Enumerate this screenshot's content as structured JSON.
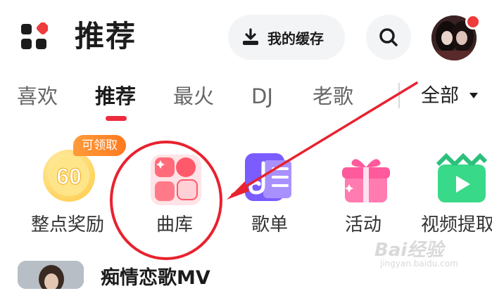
{
  "header": {
    "title": "推荐",
    "cache_label": "我的缓存",
    "icons": [
      "grid-menu-icon",
      "download-icon",
      "search-icon",
      "avatar"
    ]
  },
  "tabs": [
    {
      "label": "喜欢",
      "active": false
    },
    {
      "label": "推荐",
      "active": true
    },
    {
      "label": "最火",
      "active": false
    },
    {
      "label": "DJ",
      "active": false
    },
    {
      "label": "老歌",
      "active": false
    }
  ],
  "tab_all": "全部",
  "entries": [
    {
      "label": "整点奖励",
      "icon": "clock-coin-icon",
      "badge": "可领取",
      "value": "60"
    },
    {
      "label": "曲库",
      "icon": "library-icon"
    },
    {
      "label": "歌单",
      "icon": "playlist-icon"
    },
    {
      "label": "活动",
      "icon": "gift-icon"
    },
    {
      "label": "视频提取",
      "icon": "video-icon"
    }
  ],
  "feed": {
    "title": "痴情恋歌MV"
  },
  "watermark": {
    "text": "Bai经验",
    "url": "jingyan.baidu.com"
  },
  "colors": {
    "accent": "#ee2a3d",
    "annotation": "#e8222f"
  }
}
